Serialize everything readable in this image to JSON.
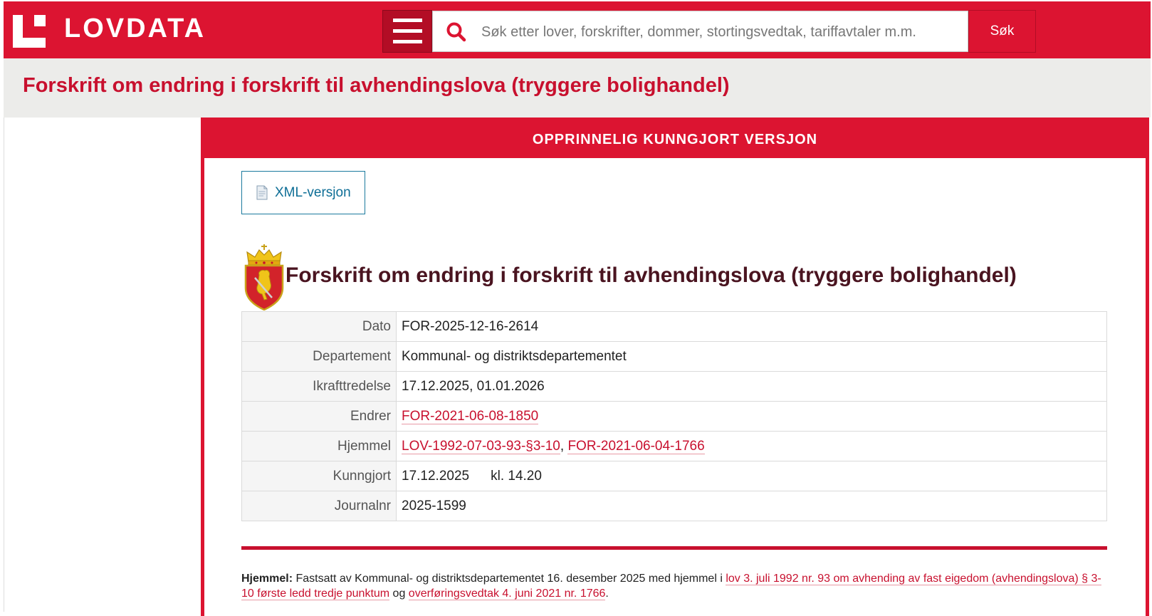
{
  "header": {
    "logo_text": "LOVDATA",
    "search_placeholder": "Søk etter lover, forskrifter, dommer, stortingsvedtak, tariffavtaler m.m.",
    "search_button_label": "Søk"
  },
  "page_title": "Forskrift om endring i forskrift til avhendingslova (tryggere bolighandel)",
  "panel": {
    "header_label": "OPPRINNELIG KUNNGJORT VERSJON",
    "xml_button_label": "XML-versjon",
    "doc_title": "Forskrift om endring i forskrift til avhendingslova (tryggere bolighandel)"
  },
  "meta": {
    "dato": {
      "label": "Dato",
      "value": "FOR-2025-12-16-2614"
    },
    "departement": {
      "label": "Departement",
      "value": "Kommunal- og distriktsdepartementet"
    },
    "ikrafttredelse": {
      "label": "Ikrafttredelse",
      "value": "17.12.2025, 01.01.2026"
    },
    "endrer": {
      "label": "Endrer",
      "link": "FOR-2021-06-08-1850"
    },
    "hjemmel": {
      "label": "Hjemmel",
      "link1": "LOV-1992-07-03-93-§3-10",
      "separator": ", ",
      "link2": "FOR-2021-06-04-1766"
    },
    "kunngjort": {
      "label": "Kunngjort",
      "date": "17.12.2025",
      "time": "kl. 14.20"
    },
    "journalnr": {
      "label": "Journalnr",
      "value": "2025-1599"
    }
  },
  "hjemmel_paragraph": {
    "label": "Hjemmel:",
    "text_before": " Fastsatt av Kommunal- og distriktsdepartementet 16. desember 2025 med hjemmel i ",
    "link1": "lov 3. juli 1992 nr. 93 om avhending av fast eigedom (avhendingslova) § 3-10 første ledd tredje punktum",
    "text_mid": " og ",
    "link2": "overføringsvedtak 4. juni 2021 nr. 1766",
    "text_end": "."
  },
  "colors": {
    "brand_red": "#dc1431",
    "title_red": "#c8102e",
    "doc_title_color": "#4a1420",
    "link_blue": "#0e6e96"
  },
  "icons": [
    "hamburger-menu-icon",
    "search-icon",
    "xml-document-icon",
    "coat-of-arms-icon"
  ]
}
